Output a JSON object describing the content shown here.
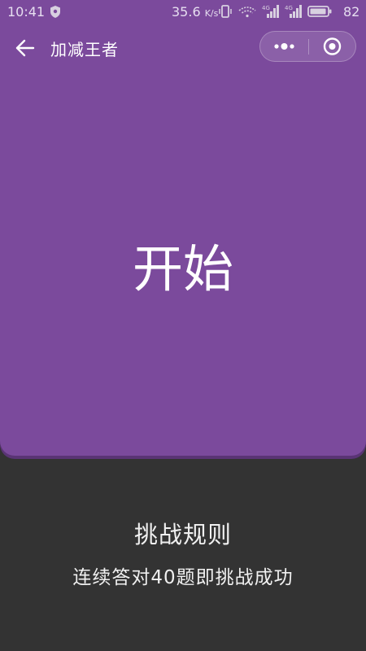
{
  "status_bar": {
    "time": "10:41",
    "speed_value": "35.6",
    "speed_unit": "K/s",
    "battery": "82"
  },
  "nav": {
    "title": "加减王者"
  },
  "main": {
    "start_label": "开始"
  },
  "rules": {
    "title": "挑战规则",
    "text": "连续答对40题即挑战成功"
  },
  "colors": {
    "panel": "#7b4a9c",
    "background": "#333333",
    "text": "#ffffff"
  }
}
